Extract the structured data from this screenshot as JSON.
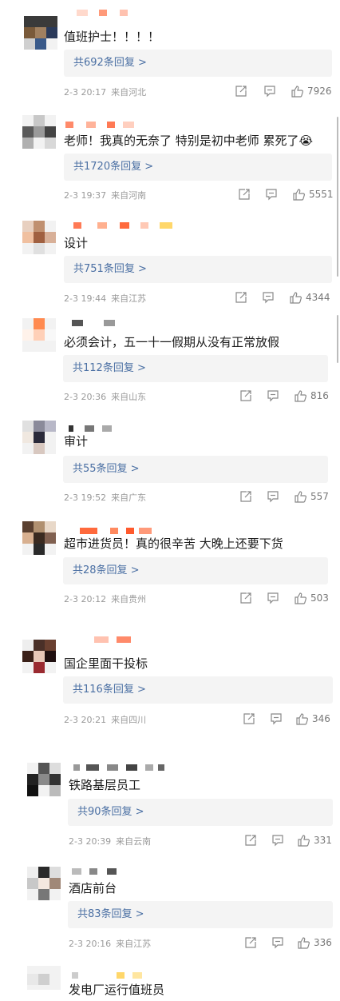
{
  "reply_label_prefix": "共",
  "reply_label_suffix": "条回复 >",
  "comments": [
    {
      "text": "值班护士！！！！",
      "replies": "共692条回复 >",
      "date": "2-3 20:17",
      "location": "来自河北",
      "likes": "7926"
    },
    {
      "text": "老师！我真的无奈了 特别是初中老师  累死了😭",
      "replies": "共1720条回复 >",
      "date": "2-3 19:37",
      "location": "来自河南",
      "likes": "5551"
    },
    {
      "text": "设计",
      "replies": "共751条回复 >",
      "date": "2-3 19:44",
      "location": "来自江苏",
      "likes": "4344"
    },
    {
      "text": "必须会计，五一十一假期从没有正常放假",
      "replies": "共112条回复 >",
      "date": "2-3 20:36",
      "location": "来自山东",
      "likes": "816"
    },
    {
      "text": "审计",
      "replies": "共55条回复 >",
      "date": "2-3 19:52",
      "location": "来自广东",
      "likes": "557"
    },
    {
      "text": "超市进货员！真的很辛苦 大晚上还要下货",
      "replies": "共28条回复 >",
      "date": "2-3 20:12",
      "location": "来自贵州",
      "likes": "503"
    },
    {
      "text": "国企里面干投标",
      "replies": "共116条回复 >",
      "date": "2-3 20:21",
      "location": "来自四川",
      "likes": "346"
    },
    {
      "text": "铁路基层员工",
      "replies": "共90条回复 >",
      "date": "2-3 20:39",
      "location": "来自云南",
      "likes": "331"
    },
    {
      "text": "酒店前台",
      "replies": "共83条回复 >",
      "date": "2-3 20:16",
      "location": "来自江苏",
      "likes": "336"
    },
    {
      "text": "发电厂运行值班员"
    }
  ],
  "colors": {
    "link": "#4a6fa3",
    "meta": "#9a9a9a",
    "reply_bg": "#f4f4f4",
    "name_blur": "#ff6a3d"
  }
}
